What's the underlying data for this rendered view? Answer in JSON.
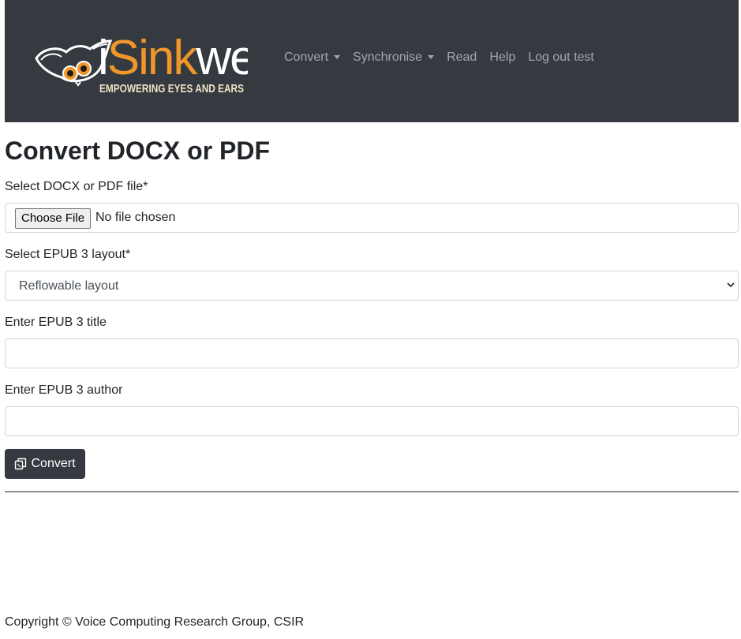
{
  "brand": {
    "name_prefix": "i",
    "name_accent": "Sink",
    "name_suffix": "we",
    "tagline": "EMPOWERING EYES AND EARS",
    "accent_color": "#f0962a"
  },
  "nav": {
    "items": [
      {
        "label": "Convert",
        "dropdown": true
      },
      {
        "label": "Synchronise",
        "dropdown": true
      },
      {
        "label": "Read",
        "dropdown": false
      },
      {
        "label": "Help",
        "dropdown": false
      },
      {
        "label": "Log out test",
        "dropdown": false
      }
    ]
  },
  "page": {
    "title": "Convert DOCX or PDF"
  },
  "form": {
    "file": {
      "label": "Select DOCX or PDF file*",
      "button_label": "Choose File",
      "status": "No file chosen"
    },
    "layout": {
      "label": "Select EPUB 3 layout*",
      "selected": "Reflowable layout"
    },
    "title": {
      "label": "Enter EPUB 3 title",
      "value": ""
    },
    "author": {
      "label": "Enter EPUB 3 author",
      "value": ""
    },
    "submit": {
      "label": "Convert",
      "icon": "copy-icon"
    }
  },
  "footer": {
    "copyright": "Copyright © Voice Computing Research Group, CSIR"
  },
  "colors": {
    "navbar_bg": "#343a40",
    "button_bg": "#343a40",
    "text": "#212529"
  }
}
